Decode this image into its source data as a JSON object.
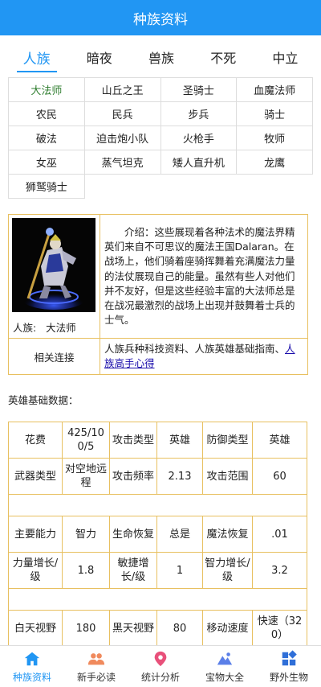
{
  "header": {
    "title": "种族资料"
  },
  "race_tabs": [
    "人族",
    "暗夜",
    "兽族",
    "不死",
    "中立"
  ],
  "units": [
    "大法师",
    "山丘之王",
    "圣骑士",
    "血魔法师",
    "农民",
    "民兵",
    "步兵",
    "骑士",
    "破法",
    "迫击炮小队",
    "火枪手",
    "牧师",
    "女巫",
    "蒸气坦克",
    "矮人直升机",
    "龙鹰",
    "狮鹫骑士"
  ],
  "intro": {
    "race_label": "人族:",
    "unit_name": "大法师",
    "text": "介绍：这些展现着各种法术的魔法界精英们来自不可思议的魔法王国Dalaran。在战场上，他们骑着座骑挥舞着充满魔法力量的法仗展现自己的能量。虽然有些人对他们并不友好，但是这些经验丰富的大法师总是在战况最激烈的战场上出现并鼓舞着士兵的士气。",
    "links_label": "相关连接",
    "links_plain": "人族兵种科技资料、人族英雄基础指南、",
    "links_anchor": "人族高手心得"
  },
  "stats": {
    "title": "英雄基础数据：",
    "rows": [
      [
        "花费",
        "425/100/5",
        "攻击类型",
        "英雄",
        "防御类型",
        "英雄"
      ],
      [
        "武器类型",
        "对空地远程",
        "攻击频率",
        "2.13",
        "攻击范围",
        "60"
      ],
      [],
      [
        "主要能力",
        "智力",
        "生命恢复",
        "总是",
        "魔法恢复",
        ".01"
      ],
      [
        "力量增长/级",
        "1.8",
        "敏捷增长/级",
        "1",
        "智力增长/级",
        "3.2"
      ],
      [],
      [
        "白天视野",
        "180",
        "黑天视野",
        "80",
        "移动速度",
        "快速（320）"
      ]
    ]
  },
  "nav": [
    {
      "label": "种族资料",
      "icon": "home-icon"
    },
    {
      "label": "新手必读",
      "icon": "users-icon"
    },
    {
      "label": "统计分析",
      "icon": "location-pin-icon"
    },
    {
      "label": "宝物大全",
      "icon": "mountain-icon"
    },
    {
      "label": "野外生物",
      "icon": "grid-icon"
    }
  ],
  "colors": {
    "accent": "#2196F3",
    "active_unit": "#2e7d2e",
    "table_border": "#e8c060"
  }
}
